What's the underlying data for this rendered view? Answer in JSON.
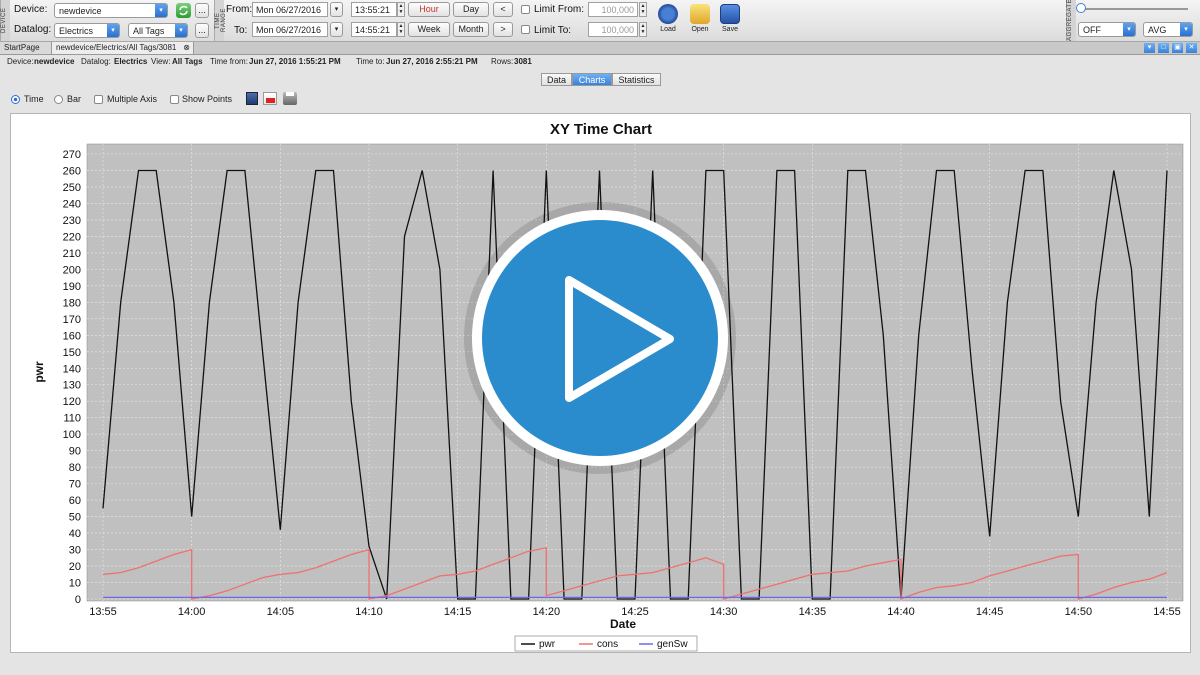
{
  "toolbar": {
    "device_section_label": "DEVICE",
    "device_label": "Device:",
    "device_value": "newdevice",
    "datalog_label": "Datalog:",
    "datalog_value": "Electrics",
    "tags_value": "All Tags",
    "more_label": "...",
    "time_range_section_label": "TIME RANGE",
    "from_label": "From:",
    "from_date": "Mon 06/27/2016",
    "from_time": "13:55:21",
    "to_label": "To:",
    "to_date": "Mon 06/27/2016",
    "to_time": "14:55:21",
    "hour_label": "Hour",
    "day_label": "Day",
    "week_label": "Week",
    "month_label": "Month",
    "prev_label": "<",
    "next_label": ">",
    "limit_from_label": "Limit From:",
    "limit_from_value": "100,000",
    "limit_to_label": "Limit To:",
    "limit_to_value": "100,000",
    "load_label": "Load",
    "open_label": "Open",
    "save_label": "Save",
    "aggregate_section_label": "AGGREGATE",
    "aggregate_value": "OFF",
    "aggregate_func": "AVG"
  },
  "tabs": [
    "StartPage",
    "newdevice/Electrics/All Tags/3081"
  ],
  "info": {
    "device_label": "Device:",
    "device": "newdevice",
    "datalog_label": "Datalog:",
    "datalog": "Electrics",
    "view_label": "View:",
    "view": "All Tags",
    "time_from_label": "Time from:",
    "time_from": "Jun 27, 2016 1:55:21 PM",
    "time_to_label": "Time to:",
    "time_to": "Jun 27, 2016 2:55:21 PM",
    "rows_label": "Rows:",
    "rows": "3081"
  },
  "subtabs": [
    "Data",
    "Charts",
    "Statistics"
  ],
  "options": {
    "time_label": "Time",
    "bar_label": "Bar",
    "multiple_axis_label": "Multiple Axis",
    "show_points_label": "Show Points"
  },
  "colors": {
    "accent": "#2a6fcf",
    "pwr": "#111111",
    "cons": "#f07070",
    "gensw": "#6a6aee",
    "plot_bg": "#c0c0c0",
    "play_button": "#2a8ccc"
  },
  "chart_data": {
    "type": "line",
    "title": "XY Time Chart",
    "xlabel": "Date",
    "ylabel": "pwr",
    "x_ticks": [
      "13:55",
      "14:00",
      "14:05",
      "14:10",
      "14:15",
      "14:20",
      "14:25",
      "14:30",
      "14:35",
      "14:40",
      "14:45",
      "14:50",
      "14:55"
    ],
    "y_ticks": [
      0,
      10,
      20,
      30,
      40,
      50,
      60,
      70,
      80,
      90,
      100,
      110,
      120,
      130,
      140,
      150,
      160,
      170,
      180,
      190,
      200,
      210,
      220,
      230,
      240,
      250,
      260,
      270
    ],
    "xlim": [
      "13:55",
      "14:55"
    ],
    "ylim": [
      0,
      270
    ],
    "grid": true,
    "legend_position": "bottom",
    "series": [
      {
        "name": "pwr",
        "color": "#111111",
        "x": [
          "13:55",
          "13:56",
          "13:57",
          "13:58",
          "13:59",
          "14:00",
          "14:01",
          "14:02",
          "14:03",
          "14:04",
          "14:05",
          "14:06",
          "14:07",
          "14:08",
          "14:09",
          "14:10",
          "14:11",
          "14:12",
          "14:13",
          "14:14",
          "14:15",
          "14:16",
          "14:17",
          "14:18",
          "14:19",
          "14:20",
          "14:21",
          "14:22",
          "14:23",
          "14:24",
          "14:25",
          "14:26",
          "14:27",
          "14:28",
          "14:29",
          "14:30",
          "14:31",
          "14:32",
          "14:33",
          "14:34",
          "14:35",
          "14:36",
          "14:37",
          "14:38",
          "14:39",
          "14:40",
          "14:41",
          "14:42",
          "14:43",
          "14:44",
          "14:45",
          "14:46",
          "14:47",
          "14:48",
          "14:49",
          "14:50",
          "14:51",
          "14:52",
          "14:53",
          "14:54",
          "14:55"
        ],
        "values": [
          55,
          180,
          260,
          260,
          180,
          50,
          180,
          260,
          260,
          150,
          42,
          180,
          260,
          260,
          120,
          32,
          0,
          220,
          260,
          200,
          0,
          0,
          260,
          0,
          0,
          260,
          0,
          0,
          260,
          0,
          0,
          260,
          0,
          0,
          260,
          260,
          0,
          0,
          260,
          260,
          0,
          0,
          260,
          260,
          160,
          0,
          160,
          260,
          260,
          140,
          38,
          180,
          260,
          260,
          120,
          50,
          180,
          260,
          200,
          50,
          260
        ]
      },
      {
        "name": "cons",
        "color": "#f07070",
        "x": [
          "13:55",
          "13:56",
          "13:57",
          "13:58",
          "13:59",
          "14:00",
          "14:00",
          "14:01",
          "14:02",
          "14:03",
          "14:04",
          "14:05",
          "14:06",
          "14:07",
          "14:08",
          "14:09",
          "14:10",
          "14:10",
          "14:11",
          "14:12",
          "14:13",
          "14:14",
          "14:15",
          "14:16",
          "14:17",
          "14:18",
          "14:19",
          "14:20",
          "14:20",
          "14:21",
          "14:22",
          "14:23",
          "14:24",
          "14:25",
          "14:26",
          "14:27",
          "14:28",
          "14:29",
          "14:30",
          "14:30",
          "14:31",
          "14:32",
          "14:33",
          "14:34",
          "14:35",
          "14:36",
          "14:37",
          "14:38",
          "14:39",
          "14:40",
          "14:40",
          "14:41",
          "14:42",
          "14:43",
          "14:44",
          "14:45",
          "14:46",
          "14:47",
          "14:48",
          "14:49",
          "14:50",
          "14:50",
          "14:51",
          "14:52",
          "14:53",
          "14:54",
          "14:55"
        ],
        "values": [
          15,
          16,
          19,
          23,
          27,
          30,
          0,
          2,
          5,
          9,
          13,
          15,
          16,
          19,
          23,
          27,
          30,
          0,
          2,
          6,
          10,
          14,
          15,
          17,
          21,
          25,
          29,
          31,
          2,
          5,
          8,
          11,
          14,
          15,
          16,
          19,
          22,
          25,
          21,
          0,
          3,
          6,
          9,
          12,
          15,
          16,
          17,
          20,
          22,
          24,
          0,
          4,
          7,
          8,
          10,
          14,
          17,
          20,
          23,
          26,
          27,
          0,
          3,
          7,
          10,
          12,
          16
        ]
      },
      {
        "name": "genSw",
        "color": "#6a6aee",
        "x": [
          "13:55",
          "14:55"
        ],
        "values": [
          1,
          1
        ]
      }
    ]
  }
}
